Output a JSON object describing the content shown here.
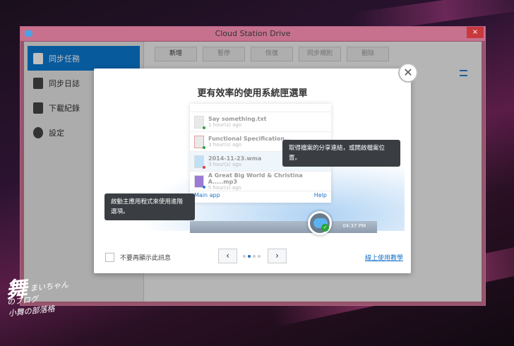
{
  "window": {
    "title": "Cloud Station Drive",
    "close": "×"
  },
  "sidebar": {
    "items": [
      {
        "label": "同步任務"
      },
      {
        "label": "同步日誌"
      },
      {
        "label": "下載紀錄"
      },
      {
        "label": "設定"
      }
    ]
  },
  "toolbar": {
    "buttons": [
      "新增",
      "暫停",
      "恢復",
      "同步規則",
      "刪除"
    ]
  },
  "dialog": {
    "title": "更有效率的使用系統匣選單",
    "close": "✕",
    "files": [
      {
        "name": "Say something.txt",
        "time": "1 hour(s) ago",
        "dot": "#2aa33a"
      },
      {
        "name": "Functional Specification...",
        "time": "3 hour(s) ago",
        "dot": "#2aa33a"
      },
      {
        "name": "2014-11-23.wma",
        "time": "3 hour(s) ago",
        "dot": "#e03c3c"
      },
      {
        "name": "A Great Big World & Christina A.....mp3",
        "time": "5 hour(s) ago",
        "dot": "#2a7fd4"
      }
    ],
    "main_app": "Main app",
    "help": "Help",
    "clock": "04:37 PM",
    "tip_share": "取得檔案的分享連結，或開啟檔案位置。",
    "tip_main": "啟動主應用程式來使用進階選項。",
    "dont_show": "不要再顯示此訊息",
    "prev": "‹",
    "next": "›",
    "page": {
      "current": 2,
      "total": 4
    },
    "tutorial_link": "線上使用教學"
  },
  "watermark": {
    "text": "まいちゃんのブログ 小舞の部落格",
    "mark": "舞"
  }
}
